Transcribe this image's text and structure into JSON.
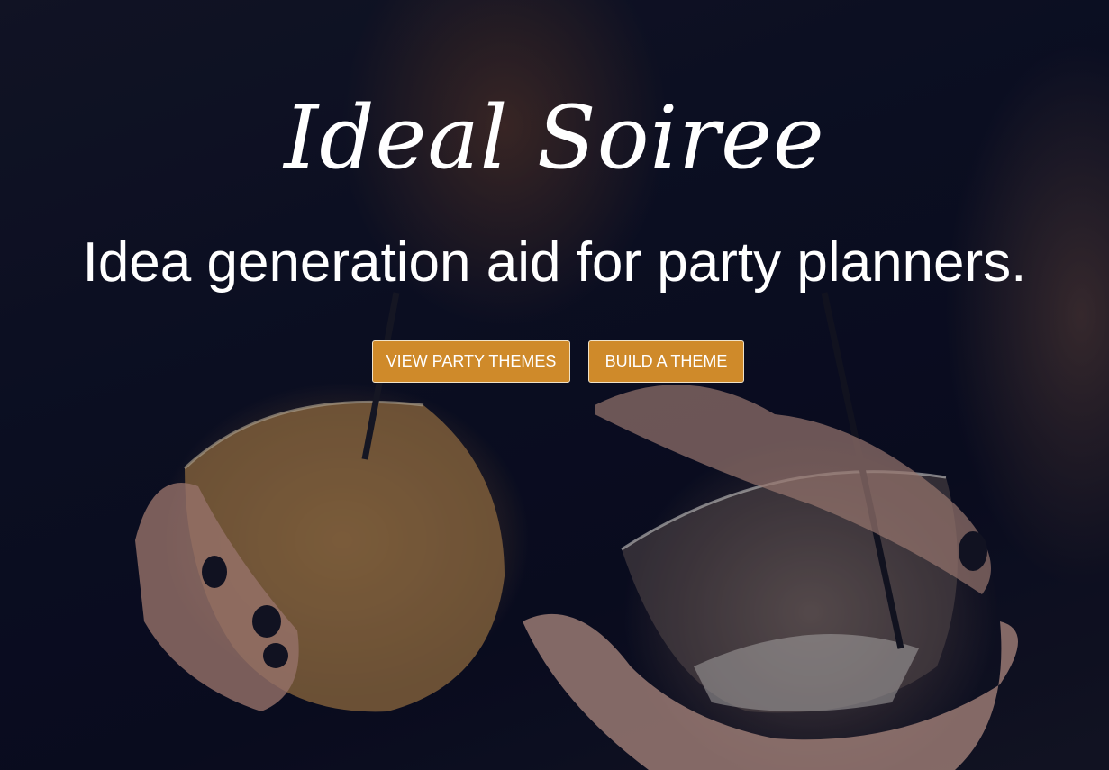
{
  "hero": {
    "title": "Ideal Soiree",
    "subtitle": "Idea generation aid for party planners.",
    "buttons": {
      "view_themes_label": "VIEW PARTY THEMES",
      "build_theme_label": "BUILD A THEME"
    }
  },
  "colors": {
    "button_background": "#cf8a2a",
    "button_border": "#f0e2c8",
    "text": "#ffffff"
  }
}
